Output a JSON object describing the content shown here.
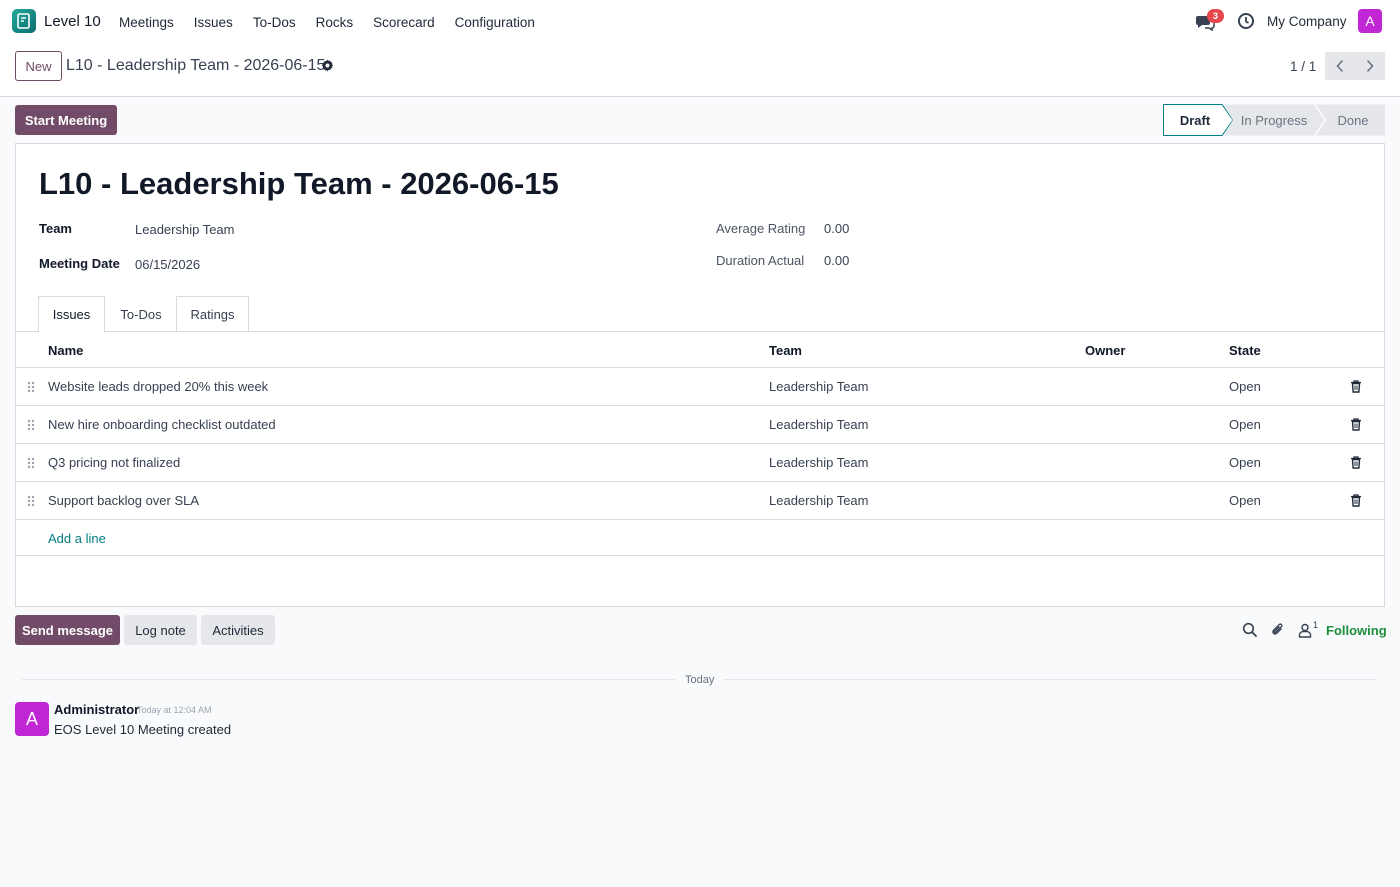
{
  "app": {
    "name": "Level 10"
  },
  "menu": [
    {
      "label": "Meetings"
    },
    {
      "label": "Issues"
    },
    {
      "label": "To-Dos"
    },
    {
      "label": "Rocks"
    },
    {
      "label": "Scorecard"
    },
    {
      "label": "Configuration"
    }
  ],
  "systray": {
    "message_count": "3",
    "company": "My Company",
    "user_initial": "A"
  },
  "control": {
    "new_label": "New",
    "breadcrumb": "L10 - Leadership Team - 2026-06-15",
    "pager": "1 / 1"
  },
  "actions": {
    "start_meeting": "Start Meeting"
  },
  "status": {
    "stages": [
      "Draft",
      "In Progress",
      "Done"
    ],
    "current": "Draft"
  },
  "form": {
    "title": "L10 - Leadership Team - 2026-06-15",
    "team_label": "Team",
    "team_value": "Leadership Team",
    "date_label": "Meeting Date",
    "date_value": "06/15/2026",
    "rating_label": "Average Rating",
    "rating_value": "0.00",
    "duration_label": "Duration Actual",
    "duration_value": "0.00"
  },
  "tabs": [
    {
      "label": "Issues"
    },
    {
      "label": "To-Dos"
    },
    {
      "label": "Ratings"
    }
  ],
  "table": {
    "columns": {
      "name": "Name",
      "team": "Team",
      "owner": "Owner",
      "state": "State"
    },
    "rows": [
      {
        "name": "Website leads dropped 20% this week",
        "team": "Leadership Team",
        "owner": "",
        "state": "Open"
      },
      {
        "name": "New hire onboarding checklist outdated",
        "team": "Leadership Team",
        "owner": "",
        "state": "Open"
      },
      {
        "name": "Q3 pricing not finalized",
        "team": "Leadership Team",
        "owner": "",
        "state": "Open"
      },
      {
        "name": "Support backlog over SLA",
        "team": "Leadership Team",
        "owner": "",
        "state": "Open"
      }
    ],
    "add_line": "Add a line"
  },
  "chatter": {
    "send_message": "Send message",
    "log_note": "Log note",
    "activities": "Activities",
    "followers_count": "1",
    "following": "Following",
    "date_separator": "Today",
    "message": {
      "initial": "A",
      "author": "Administrator",
      "date": "Today at 12:04 AM",
      "body": "EOS Level 10 Meeting created"
    }
  },
  "colors": {
    "primary": "#714b67",
    "accent": "#017e84",
    "following": "#1c8d3a",
    "avatar": "#c026d3",
    "badge": "#e5484d"
  }
}
